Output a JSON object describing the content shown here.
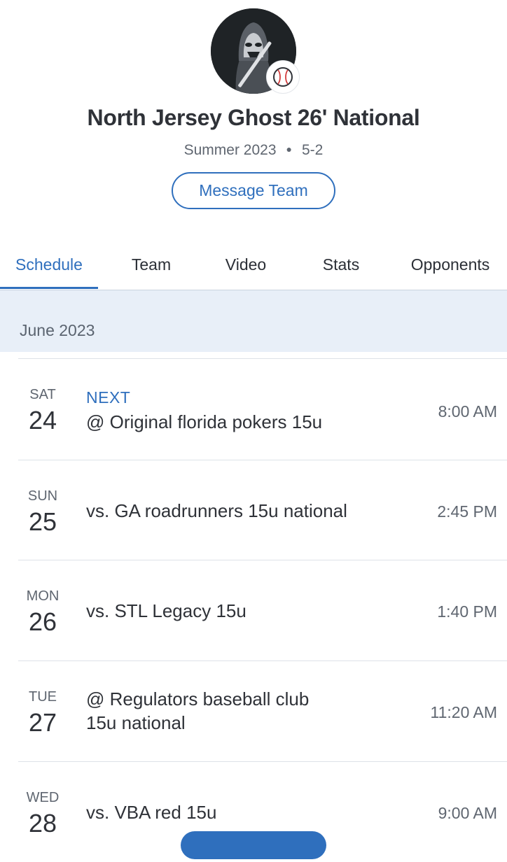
{
  "team": {
    "name": "North Jersey Ghost 26' National",
    "season": "Summer 2023",
    "record": "5-2",
    "logo_icon": "ghost-batter-logo",
    "sport_icon": "baseball-icon"
  },
  "actions": {
    "message_team": "Message Team"
  },
  "tabs": [
    {
      "label": "Schedule",
      "active": true
    },
    {
      "label": "Team"
    },
    {
      "label": "Video"
    },
    {
      "label": "Stats"
    },
    {
      "label": "Opponents"
    }
  ],
  "schedule": {
    "month": "June 2023",
    "games": [
      {
        "dow": "SAT",
        "day": "24",
        "tag": "NEXT",
        "opponent": "@ Original florida pokers 15u",
        "time": "8:00 AM"
      },
      {
        "dow": "SUN",
        "day": "25",
        "opponent": "vs. GA roadrunners 15u national",
        "time": "2:45 PM"
      },
      {
        "dow": "MON",
        "day": "26",
        "opponent": "vs. STL Legacy 15u",
        "time": "1:40 PM"
      },
      {
        "dow": "TUE",
        "day": "27",
        "opponent_line1": "@ Regulators baseball club",
        "opponent_line2": "15u national",
        "time": "11:20 AM"
      },
      {
        "dow": "WED",
        "day": "28",
        "opponent": "vs. VBA red 15u",
        "time": "9:00 AM"
      }
    ]
  },
  "colors": {
    "accent": "#2f6fbd",
    "band": "#e8eff8",
    "text": "#2f3238",
    "muted": "#5f6670"
  }
}
